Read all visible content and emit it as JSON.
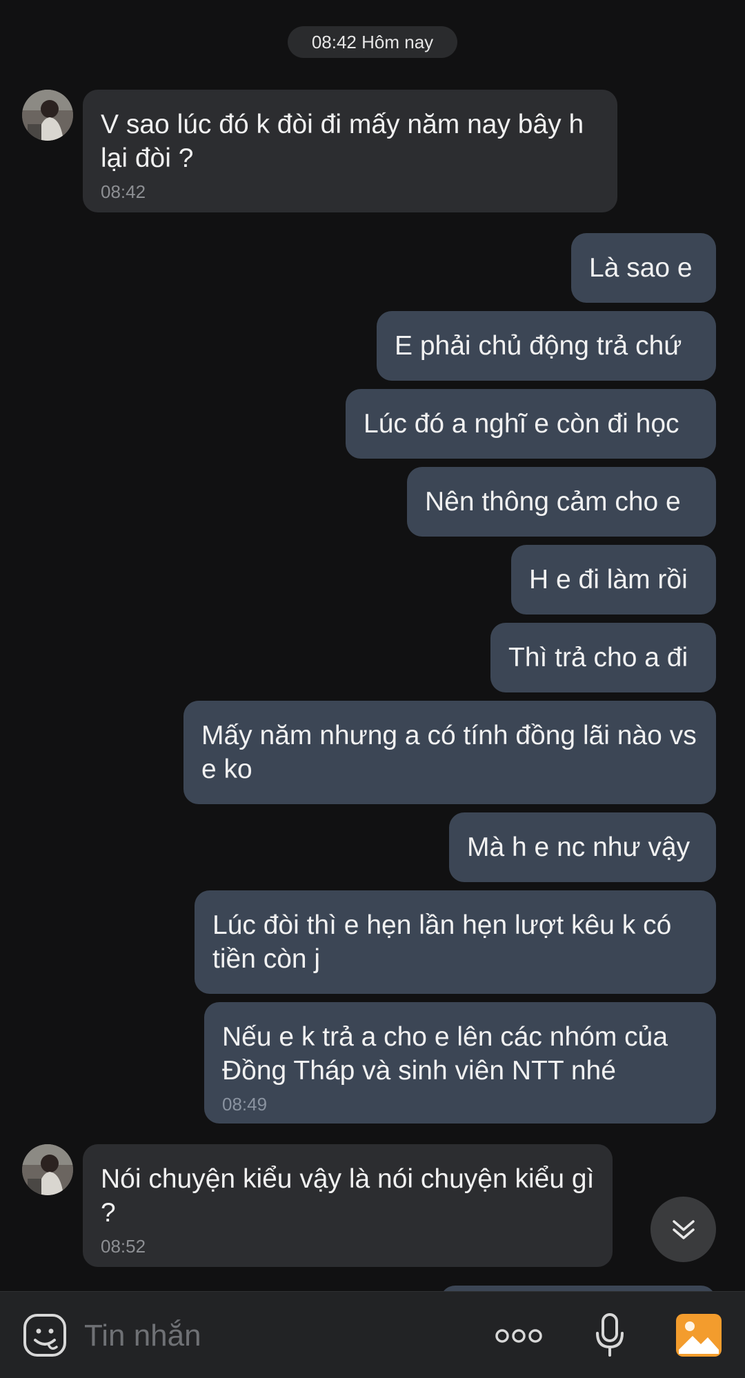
{
  "chat": {
    "date_chip": "08:42 Hôm nay",
    "messages": [
      {
        "sender": "other",
        "text": "V sao lúc đó k đòi đi mấy năm nay bây h lại đòi ?",
        "time": "08:42"
      },
      {
        "sender": "me",
        "text": "Là sao e"
      },
      {
        "sender": "me",
        "text": "E phải chủ động trả chứ"
      },
      {
        "sender": "me",
        "text": "Lúc đó a nghĩ e còn đi học"
      },
      {
        "sender": "me",
        "text": "Nên thông cảm cho e"
      },
      {
        "sender": "me",
        "text": "H e đi làm rồi"
      },
      {
        "sender": "me",
        "text": "Thì trả cho a đi"
      },
      {
        "sender": "me",
        "text": "Mấy năm nhưng a có tính đồng lãi nào vs e ko"
      },
      {
        "sender": "me",
        "text": "Mà h e nc như vậy"
      },
      {
        "sender": "me",
        "text": "Lúc đòi thì e hẹn lần hẹn lượt kêu k có tiền còn j"
      },
      {
        "sender": "me",
        "text": "Nếu e k trả a cho e lên các nhóm của Đồng Tháp và sinh viên NTT nhé",
        "time": "08:49"
      },
      {
        "sender": "other",
        "text": "Nói chuyện kiểu vậy là nói chuyện kiểu gì ?",
        "time": "08:52"
      }
    ]
  },
  "input_bar": {
    "placeholder": "Tin nhắn",
    "icons": [
      "sticker-icon",
      "more-icon",
      "microphone-icon",
      "gallery-icon"
    ]
  },
  "colors": {
    "background": "#111112",
    "incoming_bubble": "#2c2d30",
    "outgoing_bubble": "#3c4655",
    "gallery_accent": "#f39c2d"
  }
}
